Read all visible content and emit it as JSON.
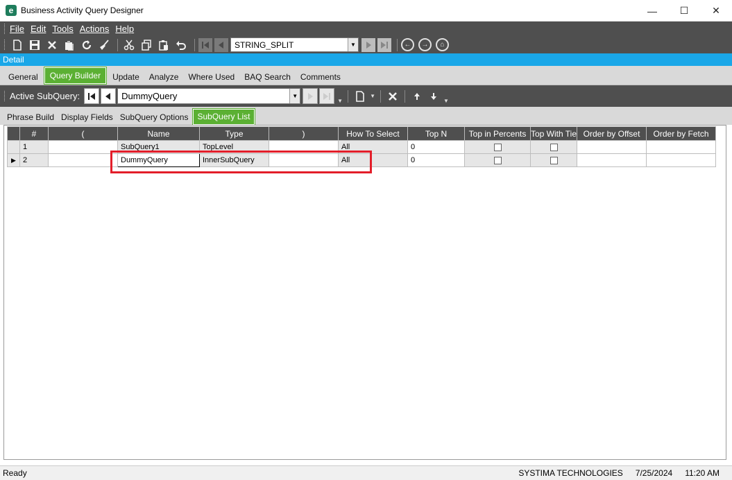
{
  "window": {
    "app_icon": "e",
    "title": "Business Activity Query Designer",
    "minimize": "—",
    "maximize": "☐",
    "close": "✕"
  },
  "menu": [
    "File",
    "Edit",
    "Tools",
    "Actions",
    "Help"
  ],
  "toolbar": {
    "query_combo_value": "STRING_SPLIT"
  },
  "detail_label": "Detail",
  "main_tabs": [
    "General",
    "Query Builder",
    "Update",
    "Analyze",
    "Where Used",
    "BAQ Search",
    "Comments"
  ],
  "main_tab_active": "Query Builder",
  "active_subquery": {
    "label": "Active SubQuery:",
    "value": "DummyQuery"
  },
  "sub_tabs": [
    "Phrase Build",
    "Display Fields",
    "SubQuery Options",
    "SubQuery List"
  ],
  "sub_tab_active": "SubQuery List",
  "grid": {
    "columns": [
      "#",
      "(",
      "Name",
      "Type",
      ")",
      "How To Select",
      "Top N",
      "Top in Percents",
      "Top With Tie",
      "Order by Offset",
      "Order by Fetch"
    ],
    "rows": [
      {
        "indicator": "",
        "num": "1",
        "open": "",
        "name": "SubQuery1",
        "type": "TopLevel",
        "close": "",
        "how": "All",
        "topn": "0"
      },
      {
        "indicator": "▶",
        "num": "2",
        "open": "",
        "name": "DummyQuery",
        "type": "InnerSubQuery",
        "close": "",
        "how": "All",
        "topn": "0"
      }
    ]
  },
  "status": {
    "left": "Ready",
    "company": "SYSTIMA TECHNOLOGIES",
    "date": "7/25/2024",
    "time": "11:20 AM"
  },
  "colors": {
    "accent_green": "#5bb033",
    "detail_blue": "#1aa7e8",
    "toolbar_gray": "#4f4f4f",
    "highlight_red": "#e31e2a"
  }
}
